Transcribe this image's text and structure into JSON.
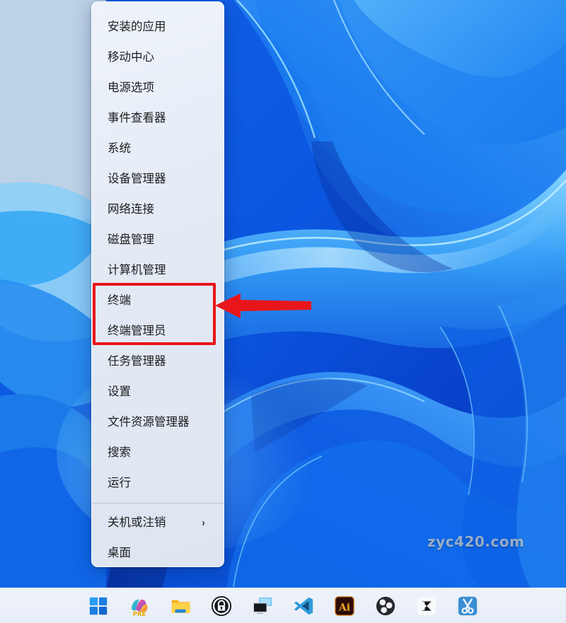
{
  "desktop": {
    "wallpaper_name": "windows-11-bloom-wallpaper",
    "watermark": "zyc420.com",
    "colors": {
      "accent_blue": "#0b63e5",
      "light_blue": "#3fa9f5",
      "deep_blue": "#0a3fd0",
      "pale_blue": "#b9cfe4",
      "menu_bg": "#e6ecf6",
      "highlight_red": "#e8161a",
      "taskbar_bg": "#eaf0fa"
    }
  },
  "context_menu": {
    "name": "win-x-power-user-menu",
    "items": [
      {
        "label": "安装的应用",
        "name": "installed-apps",
        "has_submenu": false
      },
      {
        "label": "移动中心",
        "name": "mobility-center",
        "has_submenu": false
      },
      {
        "label": "电源选项",
        "name": "power-options",
        "has_submenu": false
      },
      {
        "label": "事件查看器",
        "name": "event-viewer",
        "has_submenu": false
      },
      {
        "label": "系统",
        "name": "system",
        "has_submenu": false
      },
      {
        "label": "设备管理器",
        "name": "device-manager",
        "has_submenu": false
      },
      {
        "label": "网络连接",
        "name": "network-connections",
        "has_submenu": false
      },
      {
        "label": "磁盘管理",
        "name": "disk-management",
        "has_submenu": false
      },
      {
        "label": "计算机管理",
        "name": "computer-management",
        "has_submenu": false
      },
      {
        "label": "终端",
        "name": "terminal",
        "has_submenu": false,
        "highlighted": true
      },
      {
        "label": "终端管理员",
        "name": "terminal-admin",
        "has_submenu": false,
        "highlighted": true
      },
      {
        "label": "任务管理器",
        "name": "task-manager",
        "has_submenu": false
      },
      {
        "label": "设置",
        "name": "settings",
        "has_submenu": false
      },
      {
        "label": "文件资源管理器",
        "name": "file-explorer",
        "has_submenu": false
      },
      {
        "label": "搜索",
        "name": "search",
        "has_submenu": false
      },
      {
        "label": "运行",
        "name": "run",
        "has_submenu": false
      },
      {
        "label": "关机或注销",
        "name": "shutdown-or-signout",
        "has_submenu": true,
        "submenu_glyph": "›",
        "separator_before": true
      },
      {
        "label": "桌面",
        "name": "show-desktop",
        "has_submenu": false
      }
    ]
  },
  "annotations": {
    "highlight_box": {
      "name": "terminal-highlight-box",
      "color": "#e8161a",
      "targets": [
        "终端",
        "终端管理员"
      ]
    },
    "arrow": {
      "name": "red-pointer-arrow",
      "color": "#e8161a",
      "direction": "left"
    }
  },
  "taskbar": {
    "items": [
      {
        "name": "start-button",
        "label": "开始",
        "icon": "windows-logo-icon"
      },
      {
        "name": "copilot-button",
        "label": "PRE",
        "icon": "office-pre-icon"
      },
      {
        "name": "file-explorer-button",
        "label": "文件资源管理器",
        "icon": "folder-icon"
      },
      {
        "name": "keepass-button",
        "label": "KeePass",
        "icon": "lock-icon"
      },
      {
        "name": "remote-desktop-button",
        "label": "远程桌面",
        "icon": "remote-desktop-icon"
      },
      {
        "name": "vscode-button",
        "label": "VS Code",
        "icon": "vscode-icon"
      },
      {
        "name": "illustrator-button",
        "label": "Ai",
        "icon": "illustrator-icon"
      },
      {
        "name": "obs-button",
        "label": "OBS Studio",
        "icon": "obs-icon"
      },
      {
        "name": "capcut-button",
        "label": "CapCut",
        "icon": "capcut-icon"
      },
      {
        "name": "snipping-tool-button",
        "label": "截图工具",
        "icon": "scissors-icon"
      }
    ]
  }
}
